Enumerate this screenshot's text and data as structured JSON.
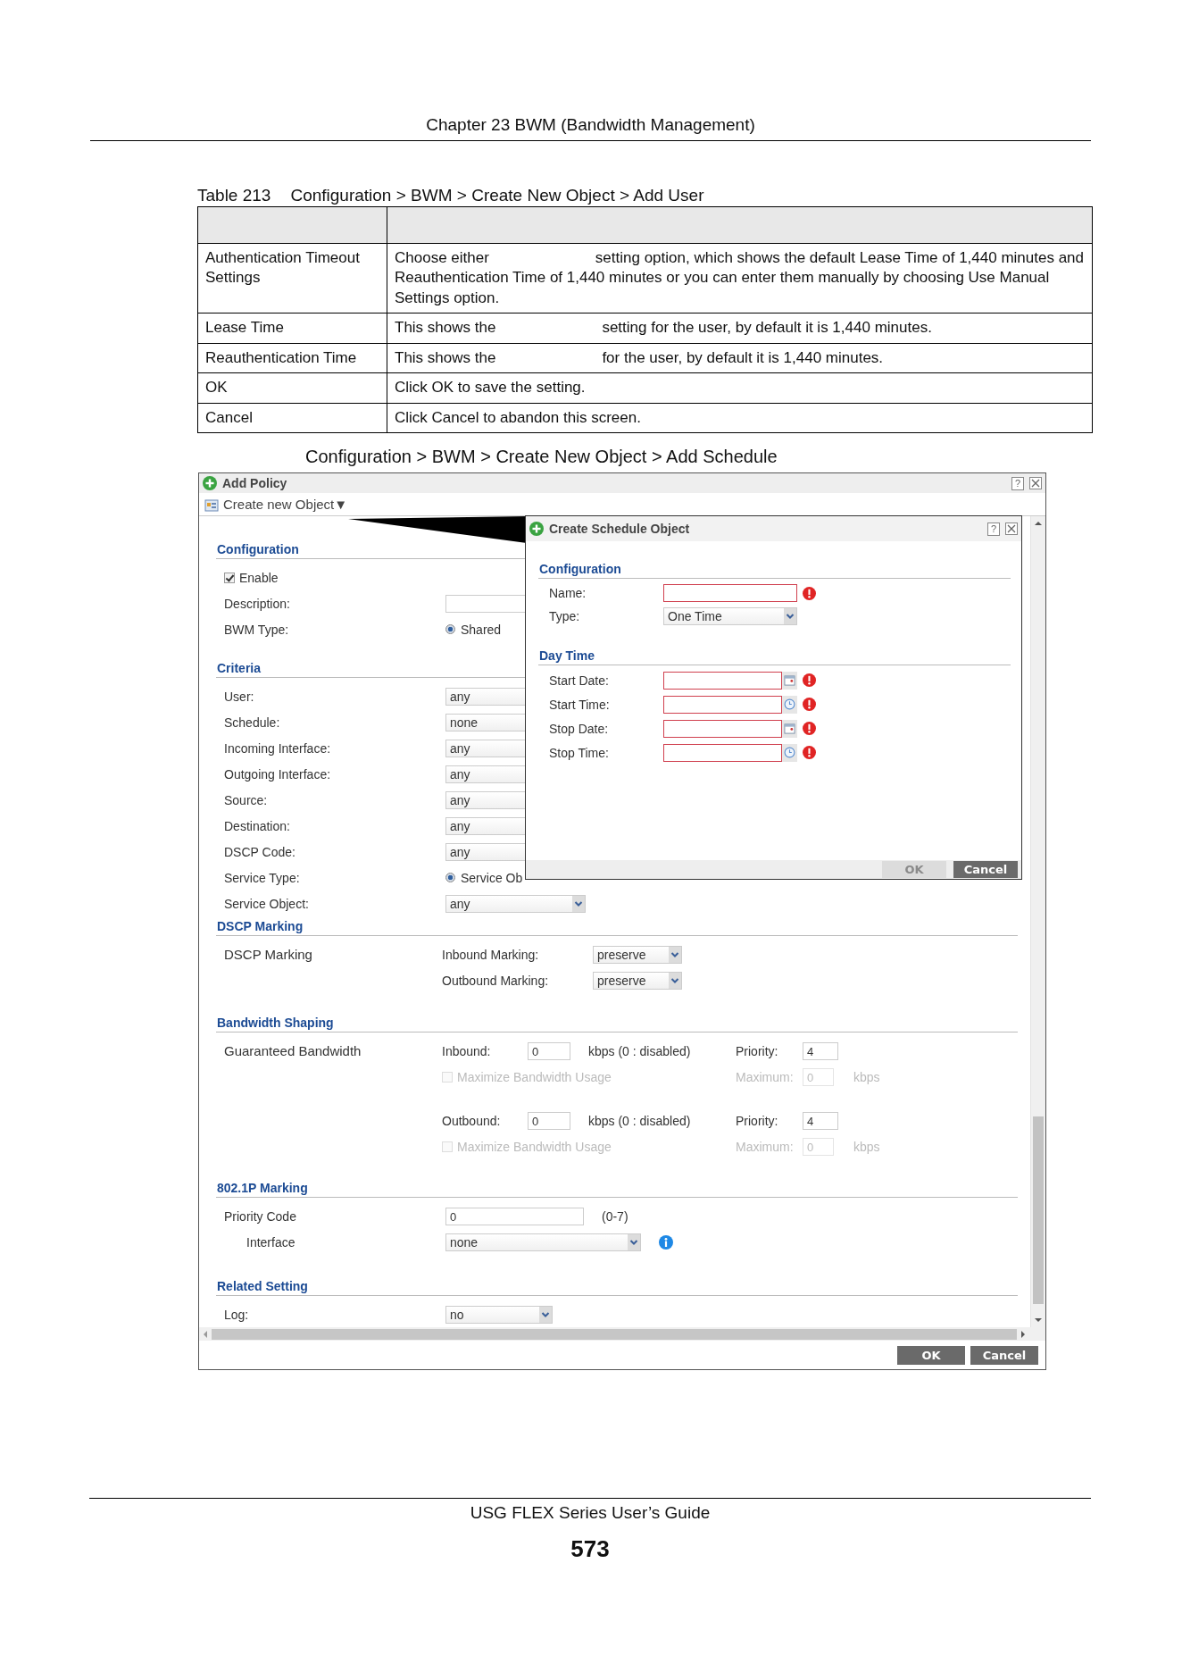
{
  "header": {
    "chapter": "Chapter 23 BWM (Bandwidth Management)"
  },
  "table": {
    "number": "Table 213",
    "caption": "Configuration > BWM > Create New Object > Add User",
    "rows": [
      {
        "label": "Authentication Timeout Settings",
        "description": [
          "Choose either",
          "setting option, which shows the default Lease Time of 1,440 minutes and Reauthentication Time of 1,440 minutes or you can enter them manually by choosing Use Manual Settings option."
        ]
      },
      {
        "label": "Lease Time",
        "description": [
          "This shows the",
          "setting for the user, by default it is 1,440 minutes."
        ]
      },
      {
        "label": "Reauthentication Time",
        "description": [
          "This shows the",
          "for the user, by default it is 1,440 minutes."
        ]
      },
      {
        "label": "OK",
        "description": [
          "Click OK to save the setting."
        ]
      },
      {
        "label": "Cancel",
        "description": [
          "Click Cancel to abandon this screen."
        ]
      }
    ]
  },
  "figure_caption": "Configuration > BWM > Create New Object > Add Schedule",
  "window": {
    "title": "Add Policy",
    "help": "?",
    "menu": "Create new Object",
    "menu_caret": "▼",
    "sections": [
      {
        "title": "Configuration",
        "rows": [
          {
            "kind": "checkbox",
            "label": "Enable",
            "checked": true
          },
          {
            "kind": "text",
            "label": "Description:"
          },
          {
            "kind": "radio",
            "label": "BWM Type:",
            "option": "Shared",
            "selected": true
          }
        ]
      },
      {
        "title": "Criteria",
        "rows": [
          {
            "kind": "select",
            "label": "User:",
            "value": "any"
          },
          {
            "kind": "select",
            "label": "Schedule:",
            "value": "none"
          },
          {
            "kind": "select",
            "label": "Incoming Interface:",
            "value": "any"
          },
          {
            "kind": "select",
            "label": "Outgoing Interface:",
            "value": "any"
          },
          {
            "kind": "select",
            "label": "Source:",
            "value": "any"
          },
          {
            "kind": "select",
            "label": "Destination:",
            "value": "any"
          },
          {
            "kind": "select",
            "label": "DSCP Code:",
            "value": "any"
          },
          {
            "kind": "radio",
            "label": "Service Type:",
            "option": "Service Ob",
            "selected": true
          },
          {
            "kind": "select",
            "label": "Service Object:",
            "value": "any"
          }
        ]
      },
      {
        "title": "DSCP Marking",
        "rows": [
          {
            "kind": "pair",
            "label": "DSCP Marking",
            "items": [
              {
                "label": "Inbound Marking:",
                "value": "preserve"
              },
              {
                "label": "Outbound Marking:",
                "value": "preserve"
              }
            ]
          }
        ]
      },
      {
        "title": "Bandwidth Shaping",
        "rows": [
          {
            "kind": "bandwidth",
            "label": "Guaranteed Bandwidth",
            "directions": [
              {
                "label": "Inbound:",
                "value": "0",
                "unit": "kbps (0 : disabled)",
                "priority_label": "Priority:",
                "priority": "4",
                "maximize": "Maximize Bandwidth Usage",
                "maximize_checked": false,
                "maximize_disabled": true,
                "maximum_label": "Maximum:",
                "maximum": "0",
                "maximum_unit": "kbps"
              },
              {
                "label": "Outbound:",
                "value": "0",
                "unit": "kbps (0 : disabled)",
                "priority_label": "Priority:",
                "priority": "4",
                "maximize": "Maximize Bandwidth Usage",
                "maximize_checked": false,
                "maximize_disabled": true,
                "maximum_label": "Maximum:",
                "maximum": "0",
                "maximum_unit": "kbps"
              }
            ]
          }
        ]
      },
      {
        "title": "802.1P Marking",
        "rows": [
          {
            "kind": "text",
            "label": "Priority Code",
            "value": "0",
            "hint": "(0-7)"
          },
          {
            "kind": "select",
            "label": "Interface",
            "value": "none",
            "info": true
          }
        ]
      },
      {
        "title": "Related Setting",
        "rows": [
          {
            "kind": "select",
            "label": "Log:",
            "value": "no"
          }
        ]
      }
    ],
    "buttons": [
      {
        "label": "OK",
        "disabled": false
      },
      {
        "label": "Cancel",
        "disabled": false
      }
    ]
  },
  "dialog": {
    "title": "Create Schedule Object",
    "help": "?",
    "sections": [
      {
        "title": "Configuration",
        "rows": [
          {
            "kind": "text",
            "label": "Name:",
            "required": true
          },
          {
            "kind": "select",
            "label": "Type:",
            "value": "One Time"
          }
        ]
      },
      {
        "title": "Day Time",
        "rows": [
          {
            "kind": "date",
            "label": "Start Date:",
            "required": true
          },
          {
            "kind": "time",
            "label": "Start Time:",
            "required": true
          },
          {
            "kind": "date",
            "label": "Stop Date:",
            "required": true
          },
          {
            "kind": "time",
            "label": "Stop Time:",
            "required": true
          }
        ]
      }
    ],
    "buttons": [
      {
        "label": "OK",
        "disabled": true
      },
      {
        "label": "Cancel",
        "disabled": false
      }
    ]
  },
  "footer": {
    "title": "USG FLEX Series User’s Guide",
    "page": "573"
  }
}
